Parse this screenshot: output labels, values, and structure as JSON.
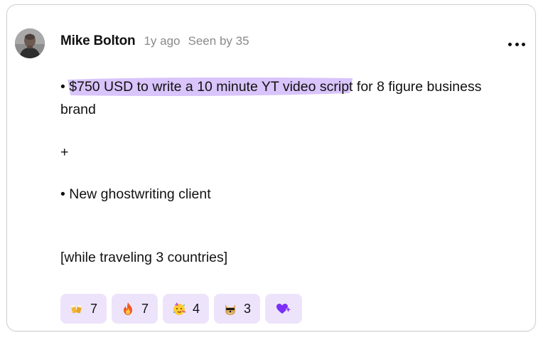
{
  "post": {
    "author": "Mike Bolton",
    "time": "1y ago",
    "seen": "Seen by 35",
    "lines": {
      "bullet1_prefix": "•",
      "bullet1_highlight": "$750 USD to write a 10 minute YT video script",
      "bullet1_rest": "for 8 figure business",
      "bullet1_wrap": "brand",
      "plus": "+",
      "bullet2": "• New ghostwriting client",
      "note": "[while traveling 3 countries]"
    },
    "highlight_color": "#d9c4fb"
  },
  "reactions": [
    {
      "emoji": "beer-mugs-icon",
      "count": "7"
    },
    {
      "emoji": "fire-icon",
      "count": "7"
    },
    {
      "emoji": "party-face-icon",
      "count": "4"
    },
    {
      "emoji": "doge-sunglasses-icon",
      "count": "3"
    }
  ],
  "accent": "#7b2ff7",
  "reaction_bg": "#ede4fb"
}
